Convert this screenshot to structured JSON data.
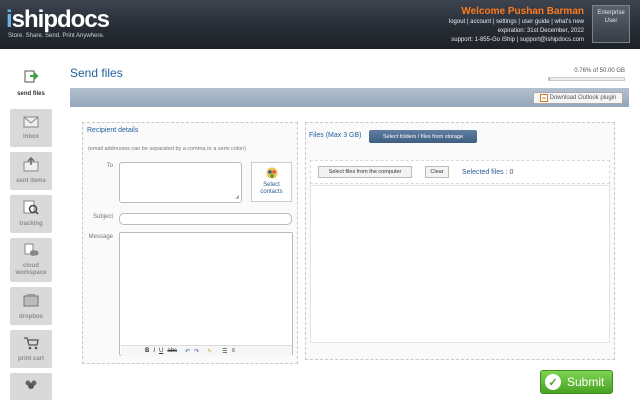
{
  "header": {
    "logo_prefix": "i",
    "logo_rest": "shipdocs",
    "tagline": "Store. Share. Send. Print Anywhere.",
    "welcome": "Welcome Pushan Barman",
    "links": "logout | account | settings | user guide | what's new",
    "expiration": "expiration: 31st December, 2022",
    "support": "support: 1-855-Go iShip | support@ishipdocs.com",
    "plan_line1": "Enterprise",
    "plan_line2": "User"
  },
  "sidebar": {
    "items": [
      {
        "label": "send files",
        "icon": "send-files-icon",
        "active": true
      },
      {
        "label": "inbox",
        "icon": "inbox-icon",
        "active": false
      },
      {
        "label": "sent items",
        "icon": "sent-items-icon",
        "active": false
      },
      {
        "label": "tracking",
        "icon": "tracking-icon",
        "active": false
      },
      {
        "label": "cloud workspace",
        "icon": "cloud-workspace-icon",
        "active": false
      },
      {
        "label": "dropbox",
        "icon": "dropbox-icon",
        "active": false
      },
      {
        "label": "print cart",
        "icon": "print-cart-icon",
        "active": false
      },
      {
        "label": "",
        "icon": "contacts-icon",
        "active": false
      }
    ]
  },
  "page": {
    "title": "Send files",
    "usage_text": "0.76% of 50.00 GB",
    "usage_percent": 0.76,
    "outlook_label": "Download Outlook plugin"
  },
  "recipient": {
    "title": "Recipient details",
    "note": "(email addresses can be separated by a comma or a semi colon)",
    "to_label": "To",
    "select_contacts_line1": "Select",
    "select_contacts_line2": "contacts",
    "subject_label": "Subject",
    "subject_value": "",
    "message_label": "Message",
    "message_value": "",
    "to_value": ""
  },
  "files": {
    "title": "Files (Max 3 GB)",
    "storage_button": "Select folders / files from storage",
    "computer_button": "Select files from the computer",
    "clear_button": "Clear",
    "selected_label": "Selected files :",
    "selected_count": "0"
  },
  "submit_label": "Submit",
  "colors": {
    "accent": "#1f5f9e",
    "welcome": "#ff7a1c",
    "submit": "#5bb633"
  }
}
